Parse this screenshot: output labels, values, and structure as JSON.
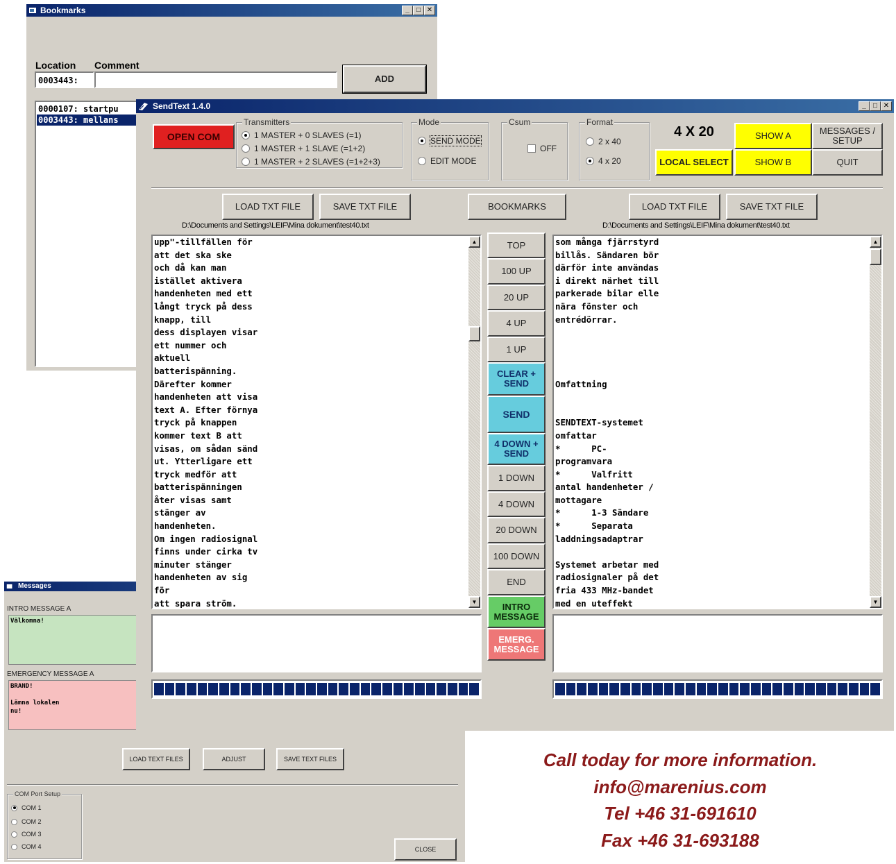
{
  "bookmarks": {
    "title": "Bookmarks",
    "location_label": "Location",
    "comment_label": "Comment",
    "location_value": "0003443:",
    "comment_value": "",
    "add_label": "ADD",
    "list": [
      "0000107: startpu",
      "0003443: mellans"
    ]
  },
  "sendtext": {
    "title": "SendText 1.4.0",
    "open_com_label": "OPEN COM",
    "transmitters": {
      "legend": "Transmitters",
      "options": [
        "1 MASTER + 0 SLAVES (=1)",
        "1 MASTER + 1 SLAVE (=1+2)",
        "1 MASTER + 2 SLAVES (=1+2+3)"
      ],
      "selected_index": 0
    },
    "mode": {
      "legend": "Mode",
      "options": [
        "SEND MODE",
        "EDIT MODE"
      ],
      "selected_index": 0
    },
    "csum": {
      "legend": "Csum",
      "label": "OFF",
      "checked": false
    },
    "format": {
      "legend": "Format",
      "options": [
        "2 x 40",
        "4 x 20"
      ],
      "selected_index": 1
    },
    "format_display": "4 X 20",
    "show_a_label": "SHOW A",
    "show_b_label": "SHOW B",
    "local_select_label": "LOCAL SELECT",
    "messages_setup_label": "MESSAGES / SETUP",
    "quit_label": "QUIT",
    "left": {
      "load_label": "LOAD TXT FILE",
      "save_label": "SAVE TXT FILE",
      "path": "D:\\Documents and Settings\\LEIF\\Mina dokument\\test40.txt",
      "text": "upp\"-tillfällen för\natt det ska ske\noch då kan man\nistället aktivera\nhandenheten med ett\nlångt tryck på dess\nknapp, till\ndess displayen visar\nett nummer och\naktuell\nbatterispänning.\nDärefter kommer\nhandenheten att visa\ntext A. Efter förnya\ntryck på knappen\nkommer text B att\nvisas, om sådan sänd\nut. Ytterligare ett\ntryck medför att\nbatterispänningen\nåter visas samt\nstänger av\nhandenheten.\nOm ingen radiosignal\nfinns under cirka tv\nminuter stänger\nhandenheten av sig\nför\natt spara ström."
    },
    "bookmarks_button_label": "BOOKMARKS",
    "right": {
      "load_label": "LOAD TXT FILE",
      "save_label": "SAVE TXT FILE",
      "path": "D:\\Documents and Settings\\LEIF\\Mina dokument\\test40.txt",
      "text": "som många fjärrstyrd\nbillås. Sändaren bör\ndärför inte användas\ni direkt närhet till\nparkerade bilar elle\nnära fönster och\nentrédörrar.\n\n\n\n\nOmfattning\n\n\nSENDTEXT-systemet\nomfattar\n*      PC-\nprogramvara\n*      Valfritt\nantal handenheter /\nmottagare\n*      1-3 Sändare\n*      Separata\nladdningsadaptrar\n\nSystemet arbetar med\nradiosignaler på det\nfria 433 MHz-bandet\nmed en uteffekt"
    },
    "nav": {
      "top": "TOP",
      "up100": "100 UP",
      "up20": "20 UP",
      "up4": "4 UP",
      "up1": "1 UP",
      "clear_send": "CLEAR + SEND",
      "send": "SEND",
      "down4_send": "4 DOWN + SEND",
      "down1": "1 DOWN",
      "down4": "4 DOWN",
      "down20": "20 DOWN",
      "down100": "100 DOWN",
      "end": "END",
      "intro": "INTRO MESSAGE",
      "emerg": "EMERG. MESSAGE"
    },
    "colors": {
      "open_com": "#e02020",
      "yellow": "#ffff00",
      "cyan": "#66ccdd",
      "intro_green": "#66cc66",
      "emerg_red": "#ee7777"
    }
  },
  "messages": {
    "title": "Messages",
    "intro_label": "INTRO MESSAGE A",
    "intro_text": "Välkomna!",
    "emergency_label": "EMERGENCY MESSAGE A",
    "emergency_text": "BRAND!\n\nLämna lokalen\nnu!",
    "load_text_files": "LOAD TEXT FILES",
    "adjust": "ADJUST",
    "save_text_files": "SAVE TEXT FILES",
    "com_legend": "COM Port Setup",
    "com_options": [
      "COM 1",
      "COM 2",
      "COM 3",
      "COM 4"
    ],
    "com_selected_index": 0,
    "close": "CLOSE"
  },
  "contact": {
    "line1": "Call today for more information.",
    "email": "info@marenius.com",
    "tel": "Tel +46 31-691610",
    "fax": "Fax +46 31-693188"
  }
}
